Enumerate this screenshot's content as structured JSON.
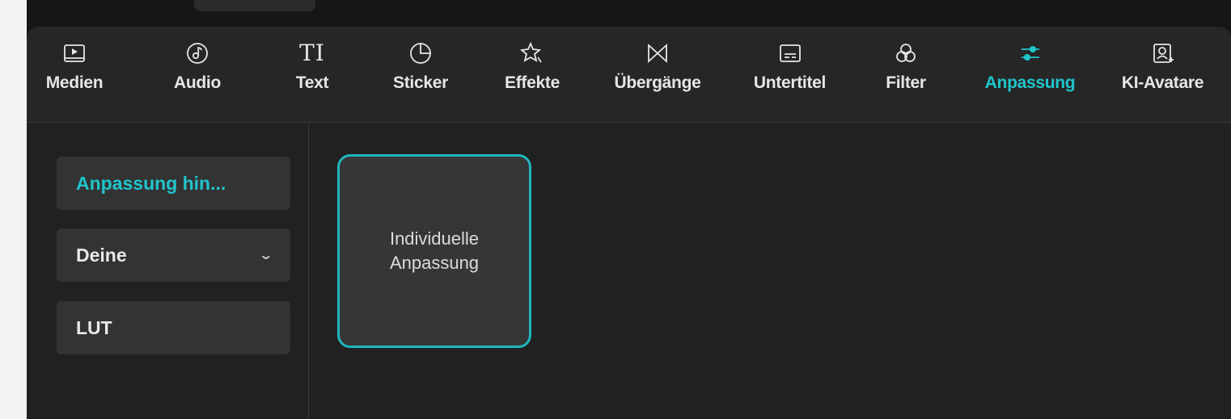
{
  "toolbar": {
    "items": [
      {
        "label": "Medien",
        "icon": "media-icon"
      },
      {
        "label": "Audio",
        "icon": "audio-icon"
      },
      {
        "label": "Text",
        "icon": "text-icon"
      },
      {
        "label": "Sticker",
        "icon": "sticker-icon"
      },
      {
        "label": "Effekte",
        "icon": "effects-icon"
      },
      {
        "label": "Übergänge",
        "icon": "transitions-icon"
      },
      {
        "label": "Untertitel",
        "icon": "subtitles-icon"
      },
      {
        "label": "Filter",
        "icon": "filter-icon"
      },
      {
        "label": "Anpassung",
        "icon": "adjustment-icon",
        "active": true
      },
      {
        "label": "KI-Avatare",
        "icon": "ai-avatar-icon"
      }
    ],
    "text_glyph": "TI"
  },
  "sidebar": {
    "items": [
      {
        "label": "Anpassung hin...",
        "active": true
      },
      {
        "label": "Deine",
        "has_dropdown": true
      },
      {
        "label": "LUT"
      }
    ],
    "dropdown_glyph": "⌄"
  },
  "main": {
    "card": {
      "line1": "Individuelle",
      "line2": "Anpassung"
    }
  },
  "colors": {
    "accent": "#20c5cc",
    "panel": "#212121",
    "toolbar": "#262626",
    "button": "#333333"
  }
}
